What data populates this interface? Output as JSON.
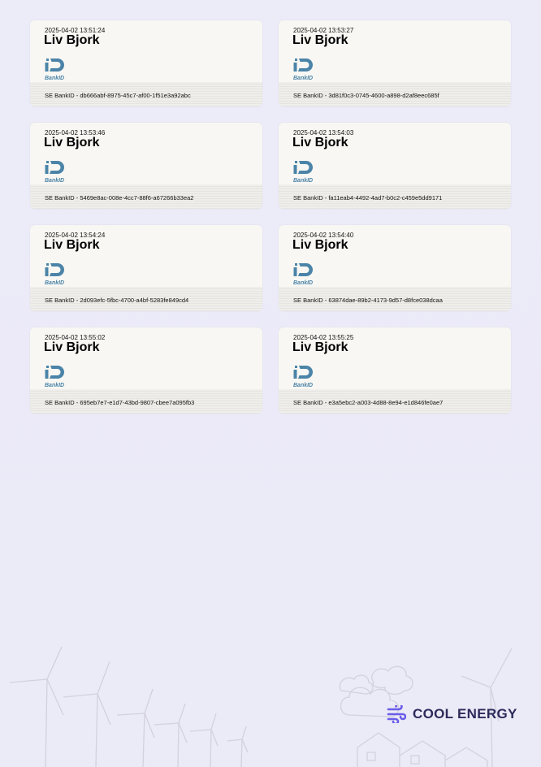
{
  "signatures": [
    {
      "timestamp": "2025-04-02 13:51:24",
      "name": "Liv Bjork",
      "logo_text": "BankID",
      "signature": "SE BankID - db666abf-8975-45c7-af00-1f51e3a92abc"
    },
    {
      "timestamp": "2025-04-02 13:53:27",
      "name": "Liv Bjork",
      "logo_text": "BankID",
      "signature": "SE BankID - 3d81f0c3-0745-4600-a898-d2af8eec685f"
    },
    {
      "timestamp": "2025-04-02 13:53:46",
      "name": "Liv Bjork",
      "logo_text": "BankID",
      "signature": "SE BankID - 5469e8ac-008e-4cc7-88f6-a67266b33ea2"
    },
    {
      "timestamp": "2025-04-02 13:54:03",
      "name": "Liv Bjork",
      "logo_text": "BankID",
      "signature": "SE BankID - fa11eab4-4492-4ad7-b0c2-c459e5dd9171"
    },
    {
      "timestamp": "2025-04-02 13:54:24",
      "name": "Liv Bjork",
      "logo_text": "BankID",
      "signature": "SE BankID - 2d093efc-5fbc-4700-a4bf-5283fe849cd4"
    },
    {
      "timestamp": "2025-04-02 13:54:40",
      "name": "Liv Bjork",
      "logo_text": "BankID",
      "signature": "SE BankID - 63874dae-89b2-4173-9d57-d8fce038dcaa"
    },
    {
      "timestamp": "2025-04-02 13:55:02",
      "name": "Liv Bjork",
      "logo_text": "BankID",
      "signature": "SE BankID - 695eb7e7-e1d7-43bd-9807-cbee7a095fb3"
    },
    {
      "timestamp": "2025-04-02 13:55:25",
      "name": "Liv Bjork",
      "logo_text": "BankID",
      "signature": "SE BankID - e3a5ebc2-a003-4d88-8e94-e1d846fe0ae7"
    }
  ],
  "footer": {
    "brand_name": "COOL ENERGY",
    "brand_icon": "wind-icon",
    "illustration": "wind-turbines-and-houses"
  },
  "colors": {
    "background": "#ecebf8",
    "card": "#f8f7f3",
    "bankid_blue": "#4b84a8",
    "brand_purple": "#6a5de8",
    "brand_text": "#2c2a5a"
  }
}
